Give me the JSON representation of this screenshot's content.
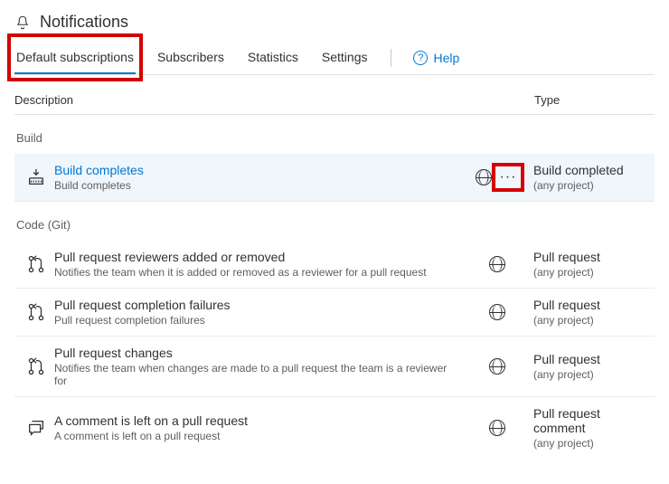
{
  "page_title": "Notifications",
  "tabs": {
    "default_subscriptions": "Default subscriptions",
    "subscribers": "Subscribers",
    "statistics": "Statistics",
    "settings": "Settings"
  },
  "help_label": "Help",
  "columns": {
    "description": "Description",
    "type": "Type"
  },
  "groups": {
    "build": {
      "label": "Build",
      "items": [
        {
          "title": "Build completes",
          "subtitle": "Build completes",
          "type_title": "Build completed",
          "type_sub": "(any project)"
        }
      ]
    },
    "code_git": {
      "label": "Code (Git)",
      "items": [
        {
          "title": "Pull request reviewers added or removed",
          "subtitle": "Notifies the team when it is added or removed as a reviewer for a pull request",
          "type_title": "Pull request",
          "type_sub": "(any project)"
        },
        {
          "title": "Pull request completion failures",
          "subtitle": "Pull request completion failures",
          "type_title": "Pull request",
          "type_sub": "(any project)"
        },
        {
          "title": "Pull request changes",
          "subtitle": "Notifies the team when changes are made to a pull request the team is a reviewer for",
          "type_title": "Pull request",
          "type_sub": "(any project)"
        },
        {
          "title": "A comment is left on a pull request",
          "subtitle": "A comment is left on a pull request",
          "type_title": "Pull request comment",
          "type_sub": "(any project)"
        }
      ]
    }
  }
}
